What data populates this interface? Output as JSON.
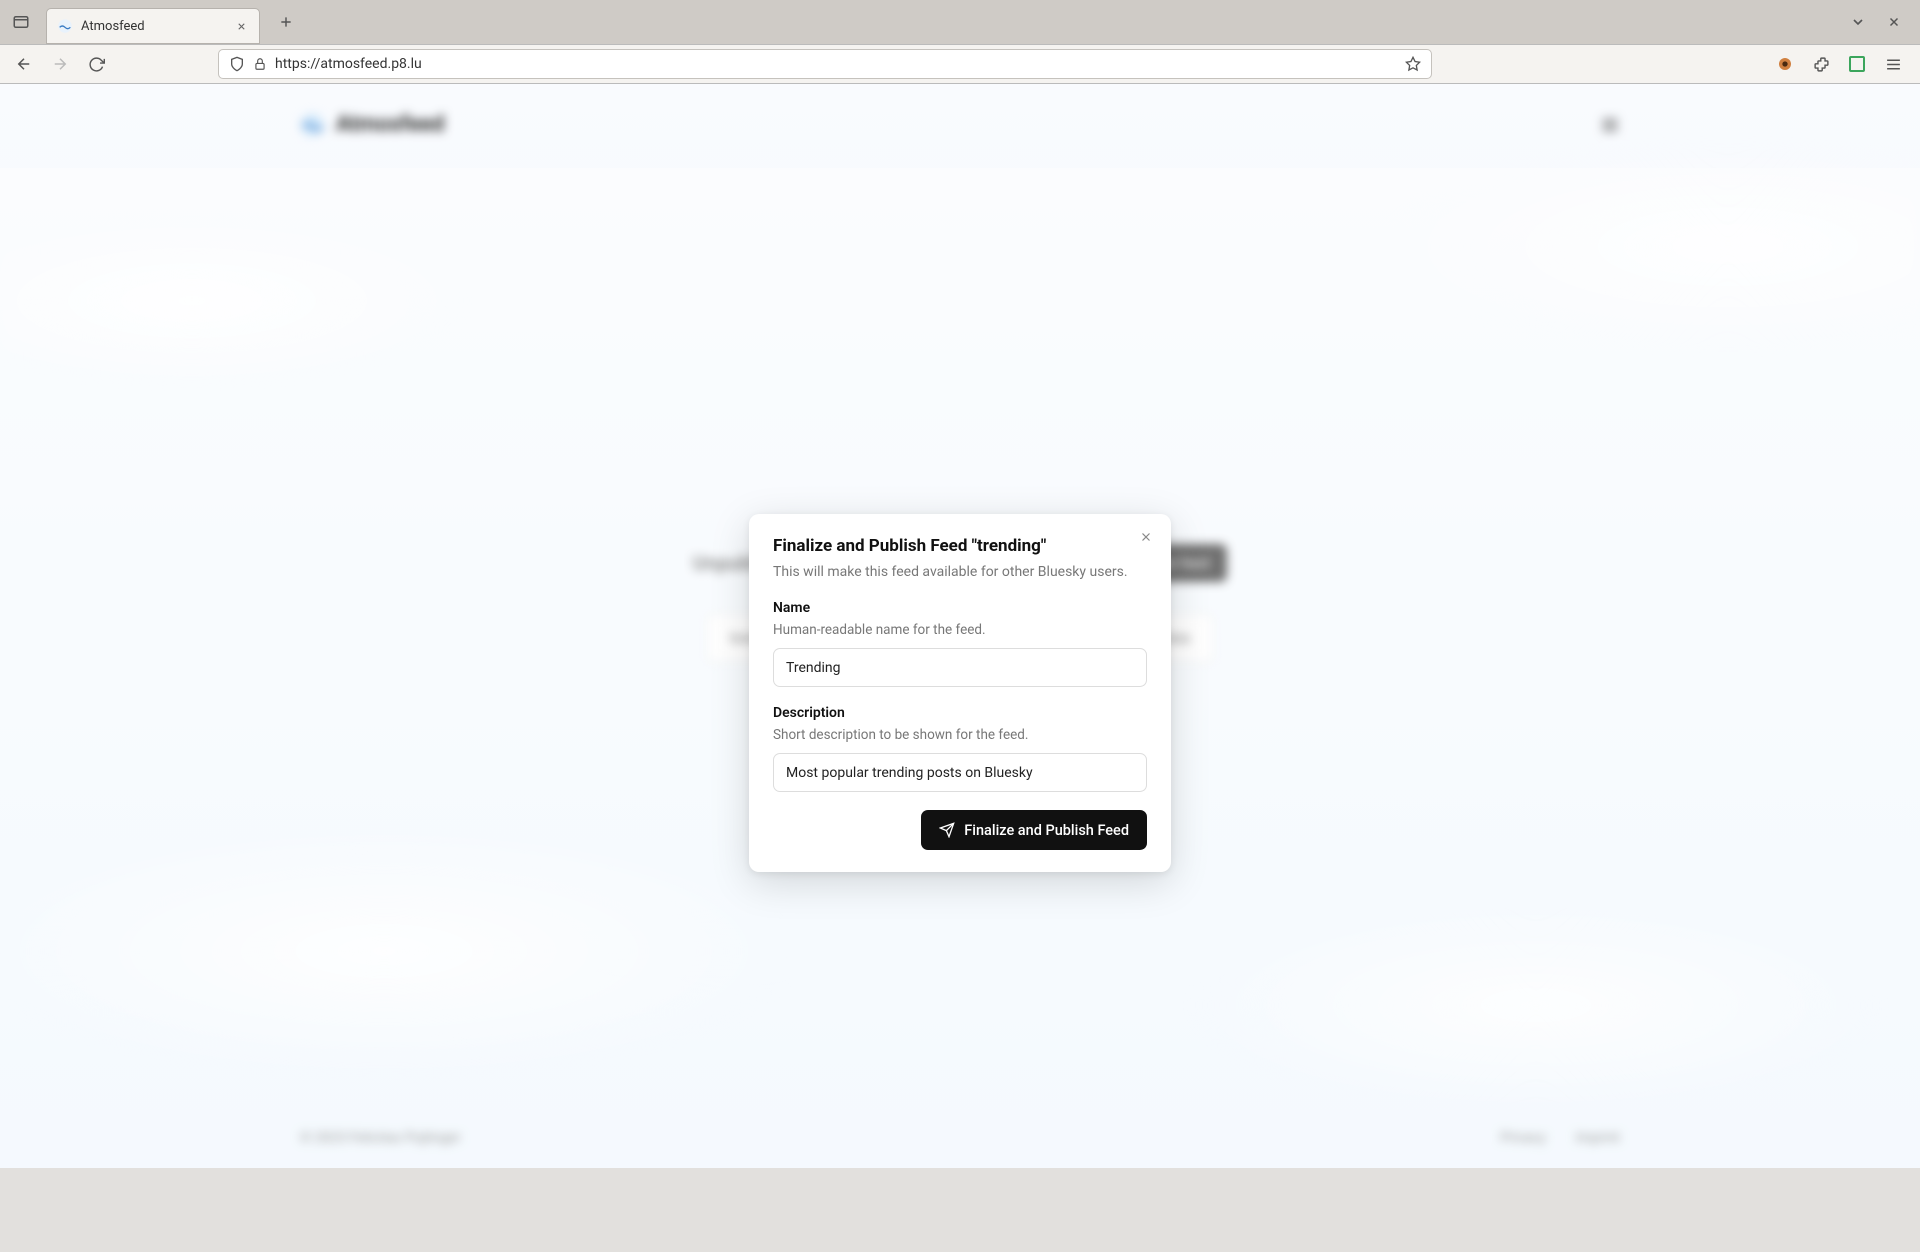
{
  "browser": {
    "tab_title": "Atmosfeed",
    "url": "https://atmosfeed.p8.lu"
  },
  "app": {
    "name": "Atmosfeed",
    "section_label": "Unpublished",
    "create_button": "Create feed",
    "feed_card_1": "trending",
    "feed_card_2": "Notes",
    "copyright": "© 2023 Felicitas Pojtinger",
    "footer_link_1": "Privacy",
    "footer_link_2": "Imprint"
  },
  "modal": {
    "title": "Finalize and Publish Feed \"trending\"",
    "subtitle": "This will make this feed available for other Bluesky users.",
    "name_label": "Name",
    "name_hint": "Human-readable name for the feed.",
    "name_value": "Trending",
    "desc_label": "Description",
    "desc_hint": "Short description to be shown for the feed.",
    "desc_value": "Most popular trending posts on Bluesky",
    "publish_button": "Finalize and Publish Feed"
  }
}
